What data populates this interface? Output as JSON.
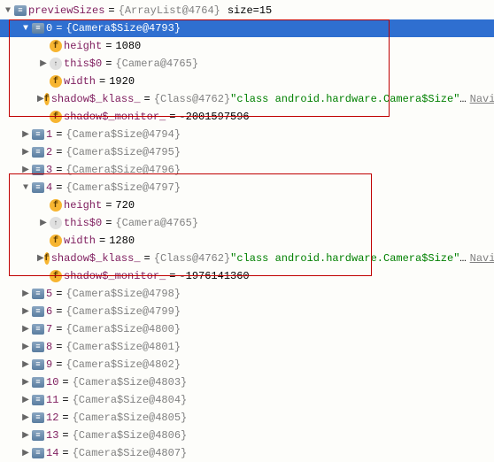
{
  "root": {
    "name": "previewSizes",
    "type": "{ArrayList@4764}",
    "sizeLabel": "size",
    "sizeValue": "15"
  },
  "items": [
    {
      "idx": "0",
      "type": "{Camera$Size@4793}",
      "expanded": true,
      "selected": true,
      "children": [
        {
          "kind": "field",
          "name": "height",
          "val": "1080"
        },
        {
          "kind": "this",
          "name": "this$0",
          "val": "{Camera@4765}",
          "expandable": true
        },
        {
          "kind": "field",
          "name": "width",
          "val": "1920"
        },
        {
          "kind": "field",
          "name": "shadow$_klass_",
          "val": "{Class@4762}",
          "str": "\"class android.hardware.Camera$Size\"",
          "extra": "…",
          "nav": "Navigate",
          "expandable": true
        },
        {
          "kind": "field",
          "name": "shadow$_monitor_",
          "val": "-2001597596"
        }
      ]
    },
    {
      "idx": "1",
      "type": "{Camera$Size@4794}"
    },
    {
      "idx": "2",
      "type": "{Camera$Size@4795}"
    },
    {
      "idx": "3",
      "type": "{Camera$Size@4796}"
    },
    {
      "idx": "4",
      "type": "{Camera$Size@4797}",
      "expanded": true,
      "children": [
        {
          "kind": "field",
          "name": "height",
          "val": "720"
        },
        {
          "kind": "this",
          "name": "this$0",
          "val": "{Camera@4765}",
          "expandable": true
        },
        {
          "kind": "field",
          "name": "width",
          "val": "1280"
        },
        {
          "kind": "field",
          "name": "shadow$_klass_",
          "val": "{Class@4762}",
          "str": "\"class android.hardware.Camera$Size\"",
          "extra": "…",
          "nav": "Navigate",
          "expandable": true
        },
        {
          "kind": "field",
          "name": "shadow$_monitor_",
          "val": "-1976141360"
        }
      ]
    },
    {
      "idx": "5",
      "type": "{Camera$Size@4798}"
    },
    {
      "idx": "6",
      "type": "{Camera$Size@4799}"
    },
    {
      "idx": "7",
      "type": "{Camera$Size@4800}"
    },
    {
      "idx": "8",
      "type": "{Camera$Size@4801}"
    },
    {
      "idx": "9",
      "type": "{Camera$Size@4802}"
    },
    {
      "idx": "10",
      "type": "{Camera$Size@4803}"
    },
    {
      "idx": "11",
      "type": "{Camera$Size@4804}"
    },
    {
      "idx": "12",
      "type": "{Camera$Size@4805}"
    },
    {
      "idx": "13",
      "type": "{Camera$Size@4806}"
    },
    {
      "idx": "14",
      "type": "{Camera$Size@4807}"
    }
  ]
}
